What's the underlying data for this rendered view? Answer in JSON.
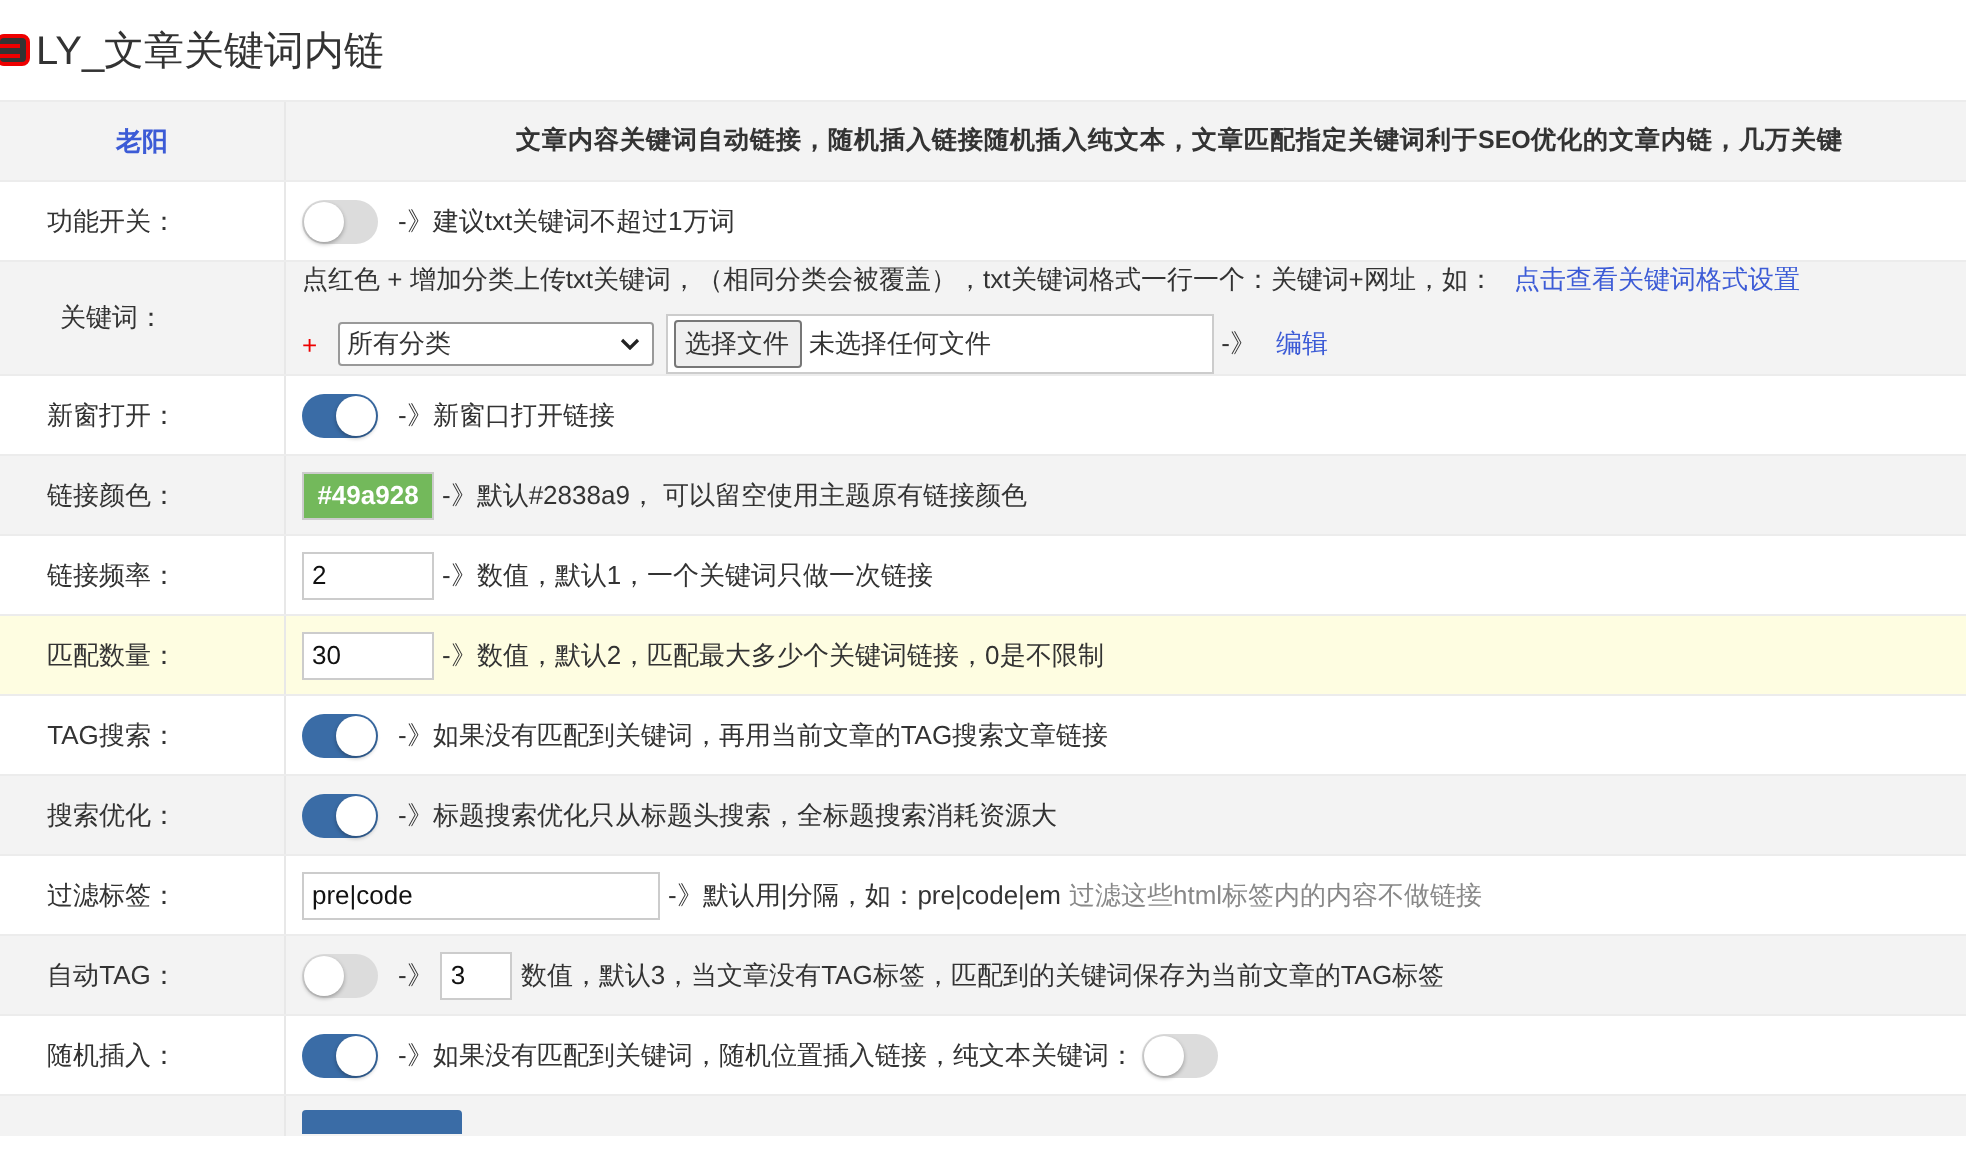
{
  "page_title": "LY_文章关键词内链",
  "header": {
    "author": "老阳",
    "description": "文章内容关键词自动链接，随机插入链接随机插入纯文本，文章匹配指定关键词利于SEO优化的文章内链，几万关键"
  },
  "rows": [
    {
      "label": "功能开关：",
      "highlighted": false,
      "lines": [
        [
          {
            "kind": "toggle",
            "on": false
          },
          {
            "kind": "text",
            "text": "-》建议txt关键词不超过1万词"
          }
        ]
      ]
    },
    {
      "label": "关键词：",
      "highlighted": false,
      "lines": [
        [
          {
            "kind": "text",
            "text": "点红色 + 增加分类上传txt关键词，（相同分类会被覆盖），txt关键词格式一行一个：关键词+网址，如："
          },
          {
            "kind": "link",
            "text": "点击查看关键词格式设置"
          }
        ],
        [
          {
            "kind": "plus",
            "text": "+"
          },
          {
            "kind": "select",
            "value": "所有分类"
          },
          {
            "kind": "file",
            "button": "选择文件",
            "status": "未选择任何文件"
          },
          {
            "kind": "text",
            "text": "-》"
          },
          {
            "kind": "link",
            "text": "编辑"
          }
        ]
      ]
    },
    {
      "label": "新窗打开：",
      "highlighted": false,
      "lines": [
        [
          {
            "kind": "toggle",
            "on": true
          },
          {
            "kind": "text",
            "text": "-》新窗口打开链接"
          }
        ]
      ]
    },
    {
      "label": "链接颜色：",
      "highlighted": false,
      "lines": [
        [
          {
            "kind": "color",
            "value": "#49a928",
            "color": "#73b95b"
          },
          {
            "kind": "text",
            "text": "-》默认#2838a9， 可以留空使用主题原有链接颜色"
          }
        ]
      ]
    },
    {
      "label": "链接频率：",
      "highlighted": false,
      "lines": [
        [
          {
            "kind": "number",
            "value": "2"
          },
          {
            "kind": "text",
            "text": "-》数值，默认1，一个关键词只做一次链接"
          }
        ]
      ]
    },
    {
      "label": "匹配数量：",
      "highlighted": true,
      "lines": [
        [
          {
            "kind": "number",
            "value": "30"
          },
          {
            "kind": "text",
            "text": "-》数值，默认2，匹配最大多少个关键词链接，0是不限制"
          }
        ]
      ]
    },
    {
      "label": "TAG搜索：",
      "highlighted": false,
      "lines": [
        [
          {
            "kind": "toggle",
            "on": true
          },
          {
            "kind": "text",
            "text": "-》如果没有匹配到关键词，再用当前文章的TAG搜索文章链接"
          }
        ]
      ]
    },
    {
      "label": "搜索优化：",
      "highlighted": false,
      "lines": [
        [
          {
            "kind": "toggle",
            "on": true
          },
          {
            "kind": "text",
            "text": "-》标题搜索优化只从标题头搜索，全标题搜索消耗资源大"
          }
        ]
      ]
    },
    {
      "label": "过滤标签：",
      "highlighted": false,
      "lines": [
        [
          {
            "kind": "tags",
            "value": "pre|code"
          },
          {
            "kind": "text",
            "text": "-》默认用|分隔，如：pre|code|em"
          },
          {
            "kind": "hint",
            "text": "过滤这些html标签内的内容不做链接"
          }
        ]
      ]
    },
    {
      "label": "自动TAG：",
      "highlighted": false,
      "lines": [
        [
          {
            "kind": "toggle",
            "on": false
          },
          {
            "kind": "text",
            "text": "-》"
          },
          {
            "kind": "count",
            "value": "3"
          },
          {
            "kind": "text",
            "text": "数值，默认3，当文章没有TAG标签，匹配到的关键词保存为当前文章的TAG标签"
          }
        ]
      ]
    },
    {
      "label": "随机插入：",
      "highlighted": false,
      "lines": [
        [
          {
            "kind": "toggle",
            "on": true
          },
          {
            "kind": "text",
            "text": "-》如果没有匹配到关键词，随机位置插入链接，纯文本关键词："
          },
          {
            "kind": "toggle",
            "on": false
          }
        ]
      ]
    }
  ]
}
